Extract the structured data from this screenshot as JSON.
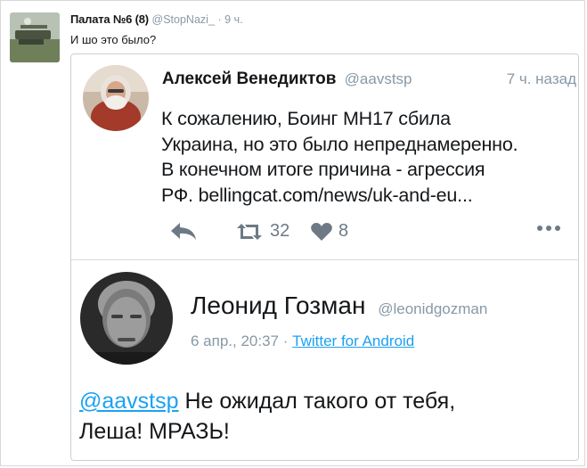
{
  "outer": {
    "name": "Палата №6 (8)",
    "handle": "@StopNazi_",
    "time": "9 ч.",
    "text": "И шо это было?"
  },
  "tweet1": {
    "name": "Алексей Венедиктов",
    "handle": "@aavstsp",
    "time": "7 ч. назад",
    "lines": [
      "К сожалению, Боинг МН17 сбила",
      "Украина, но это было непреднамеренно.",
      "В конечном итоге причина - агрессия",
      "РФ.  bellingcat.com/news/uk-and-eu..."
    ],
    "retweets": "32",
    "likes": "8"
  },
  "tweet2": {
    "name": "Леонид Гозман",
    "handle": "@leonidgozman",
    "date": "6 апр., 20:37",
    "separator": "·",
    "source": "Twitter for Android",
    "mention": "@aavstsp",
    "text_line1": "Не ожидал такого от тебя,",
    "text_line2": "Леша! МРАЗЬ!"
  },
  "colors": {
    "link": "#1da1f2",
    "muted": "#8899a6",
    "text": "#14171a"
  }
}
